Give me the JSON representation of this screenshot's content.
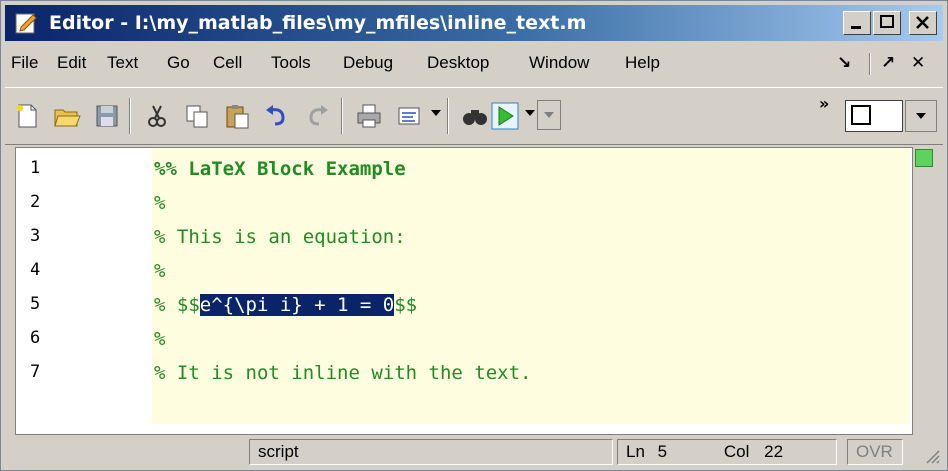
{
  "window": {
    "title": "Editor - I:\\my_matlab_files\\my_mfiles\\inline_text.m"
  },
  "menu": {
    "items": [
      "File",
      "Edit",
      "Text",
      "Go",
      "Cell",
      "Tools",
      "Debug",
      "Desktop",
      "Window",
      "Help"
    ],
    "right": [
      "↘",
      "↗",
      "✕"
    ]
  },
  "toolbar": {
    "icons": [
      "new-file-icon",
      "open-folder-icon",
      "save-icon",
      "cut-icon",
      "copy-icon",
      "paste-icon",
      "undo-icon",
      "redo-icon",
      "print-icon",
      "comment-icon",
      "find-icon",
      "run-icon"
    ]
  },
  "editor": {
    "lines": [
      {
        "num": "1",
        "text": "%% LaTeX Block Example",
        "bold": true
      },
      {
        "num": "2",
        "text": "%"
      },
      {
        "num": "3",
        "text": "% This is an equation:"
      },
      {
        "num": "4",
        "text": "%"
      },
      {
        "num": "5",
        "pre": "% $$",
        "selected": "e^{\\pi i} + 1 = 0",
        "post": "$$"
      },
      {
        "num": "6",
        "text": "%"
      },
      {
        "num": "7",
        "text": "% It is not inline with the text."
      }
    ],
    "code_color": "#228b22",
    "selection_color": "#0a246a"
  },
  "status": {
    "mode": "script",
    "ln_label": "Ln",
    "ln": "5",
    "col_label": "Col",
    "col": "22",
    "ovr": "OVR"
  }
}
